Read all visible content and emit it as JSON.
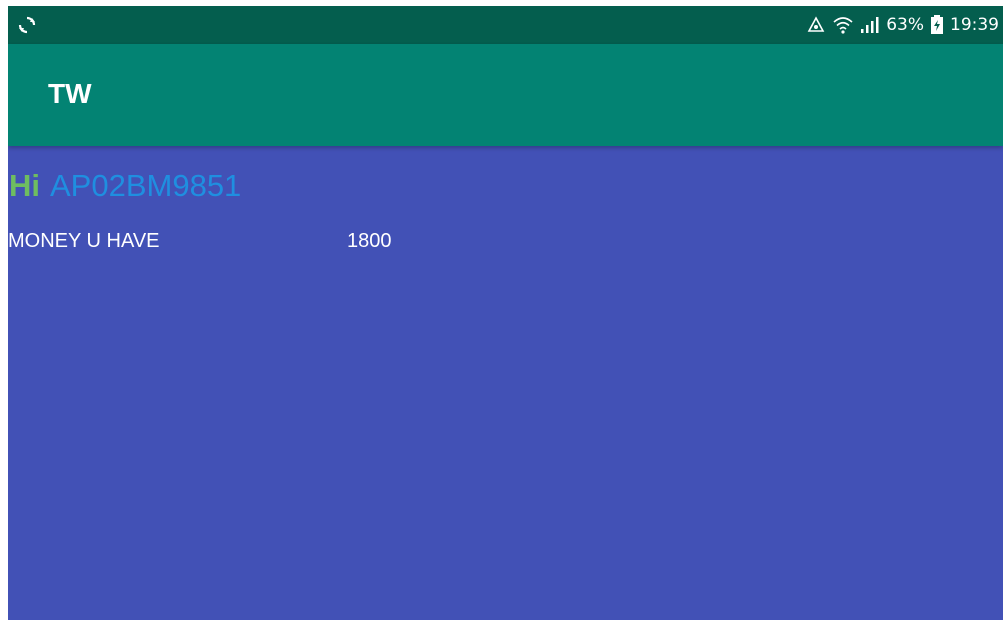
{
  "status_bar": {
    "battery": "63%",
    "time": "19:39",
    "icons": [
      "sync-icon",
      "recycle-icon",
      "wifi-icon",
      "signal-icon",
      "battery-icon"
    ]
  },
  "app_bar": {
    "title": "TW"
  },
  "main": {
    "greeting": "Hi",
    "vehicle_number": "AP02BM9851",
    "money_label": "MONEY U HAVE",
    "money_value": "1800"
  },
  "colors": {
    "status_bar": "#045E4E",
    "app_bar": "#038373",
    "background": "#4251B6",
    "greeting": "#6EBD60",
    "vehicle_number": "#1F8FE0",
    "text": "#FFFFFF"
  }
}
